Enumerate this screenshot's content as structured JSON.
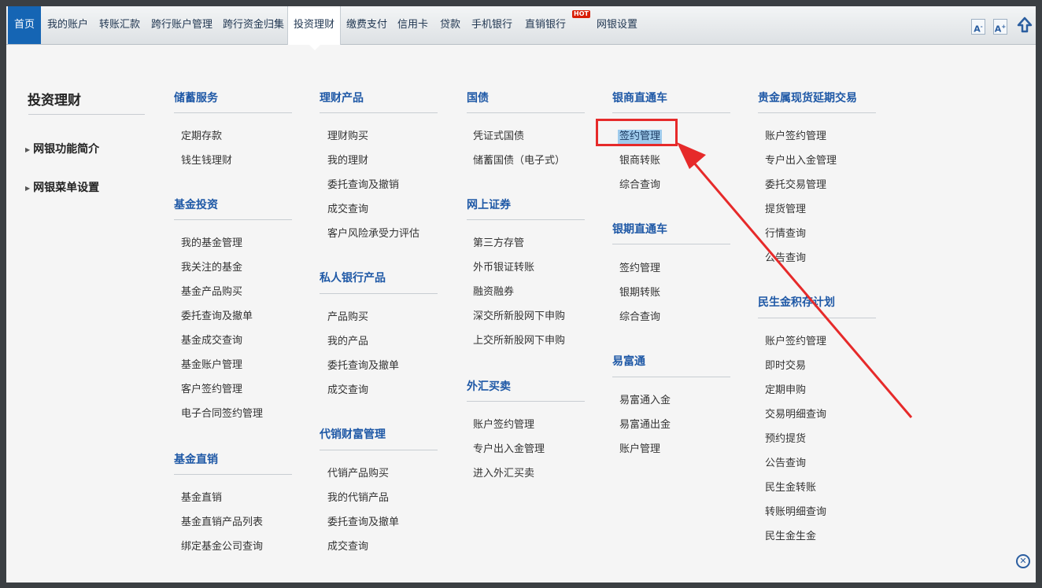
{
  "nav": {
    "home": "首页",
    "items": [
      "我的账户",
      "转账汇款",
      "跨行账户管理",
      "跨行资金归集",
      "投资理财",
      "缴费支付",
      "信用卡",
      "贷款",
      "手机银行",
      "直销银行",
      "网银设置"
    ],
    "hot_badge": "HOT",
    "tools": {
      "font_small": "A",
      "font_large": "A",
      "top_icon": "arrow-up-icon"
    }
  },
  "panel": {
    "title": "投资理财",
    "side_links": [
      "网银功能简介",
      "网银菜单设置"
    ],
    "sections": [
      {
        "title": "储蓄服务",
        "items": [
          "定期存款",
          "钱生钱理财"
        ]
      },
      {
        "title": "基金投资",
        "items": [
          "我的基金管理",
          "我关注的基金",
          "基金产品购买",
          "委托查询及撤单",
          "基金成交查询",
          "基金账户管理",
          "客户签约管理",
          "电子合同签约管理"
        ]
      },
      {
        "title": "基金直销",
        "items": [
          "基金直销",
          "基金直销产品列表",
          "绑定基金公司查询"
        ]
      },
      {
        "title": "理财产品",
        "items": [
          "理财购买",
          "我的理财",
          "委托查询及撤销",
          "成交查询",
          "客户风险承受力评估"
        ]
      },
      {
        "title": "私人银行产品",
        "items": [
          "产品购买",
          "我的产品",
          "委托查询及撤单",
          "成交查询"
        ]
      },
      {
        "title": "代销财富管理",
        "items": [
          "代销产品购买",
          "我的代销产品",
          "委托查询及撤单",
          "成交查询"
        ]
      },
      {
        "title": "国债",
        "items": [
          "凭证式国债",
          "储蓄国债（电子式）"
        ]
      },
      {
        "title": "网上证券",
        "items": [
          "第三方存管",
          "外币银证转账",
          "融资融券",
          "深交所新股网下申购",
          "上交所新股网下申购"
        ]
      },
      {
        "title": "外汇买卖",
        "items": [
          "账户签约管理",
          "专户出入金管理",
          "进入外汇买卖"
        ]
      },
      {
        "title": "银商直通车",
        "items": [
          "签约管理",
          "银商转账",
          "综合查询"
        ]
      },
      {
        "title": "银期直通车",
        "items": [
          "签约管理",
          "银期转账",
          "综合查询"
        ]
      },
      {
        "title": "易富通",
        "items": [
          "易富通入金",
          "易富通出金",
          "账户管理"
        ]
      },
      {
        "title": "贵金属现货延期交易",
        "items": [
          "账户签约管理",
          "专户出入金管理",
          "委托交易管理",
          "提货管理",
          "行情查询",
          "公告查询"
        ]
      },
      {
        "title": "民生金积存计划",
        "items": [
          "账户签约管理",
          "即时交易",
          "定期申购",
          "交易明细查询",
          "预约提货",
          "公告查询",
          "民生金转账",
          "转账明细查询",
          "民生金生金"
        ]
      }
    ]
  },
  "colors": {
    "accent": "#1565b4",
    "section_title": "#1e58a6",
    "highlight": "#e62a2a",
    "selected_bg": "#9fcbec"
  }
}
